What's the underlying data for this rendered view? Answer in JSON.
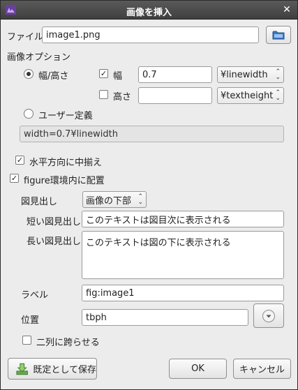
{
  "dialog": {
    "title": "画像を挿入"
  },
  "file": {
    "label": "ファイル",
    "value": "image1.png"
  },
  "image_options": {
    "label": "画像オプション",
    "width_height_radio": "幅/高さ",
    "width_checkbox": "幅",
    "width_value": "0.7",
    "width_unit": "¥linewidth",
    "height_checkbox": "高さ",
    "height_value": "",
    "height_unit": "¥textheight",
    "user_defined_radio": "ユーザー定義",
    "user_defined_value": "width=0.7¥linewidth"
  },
  "center_checkbox": "水平方向に中揃え",
  "figure_checkbox": "figure環境内に配置",
  "caption": {
    "label": "図見出し",
    "position": "画像の下部",
    "short_label": "短い図見出し",
    "short_value": "このテキストは図目次に表示される",
    "long_label": "長い図見出し",
    "long_value": "このテキストは図の下に表示される"
  },
  "label_field": {
    "label": "ラベル",
    "value": "fig:image1"
  },
  "position_field": {
    "label": "位置",
    "value": "tbph"
  },
  "span_columns": "二列に跨らせる",
  "buttons": {
    "save_default": "既定として保存",
    "ok": "OK",
    "cancel": "キャンセル"
  },
  "colors": {
    "titlebar": "#4a4a4a",
    "window_bg": "#ececec",
    "accent": "#2a6db5"
  }
}
